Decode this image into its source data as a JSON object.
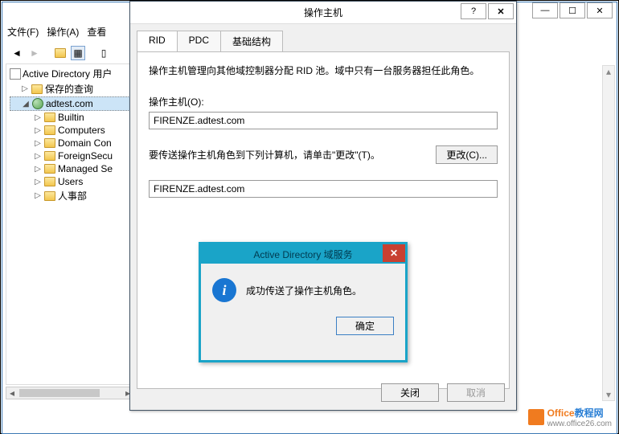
{
  "bgWindow": {
    "menus": [
      "文件(F)",
      "操作(A)",
      "查看"
    ],
    "treeRoot": "Active Directory 用户",
    "treeItems": [
      {
        "label": "保存的查询",
        "lvl": 1,
        "exp": "▷"
      },
      {
        "label": "adtest.com",
        "lvl": 1,
        "exp": "◢",
        "sel": true,
        "icon": "globe"
      },
      {
        "label": "Builtin",
        "lvl": 2,
        "exp": "▷"
      },
      {
        "label": "Computers",
        "lvl": 2,
        "exp": "▷"
      },
      {
        "label": "Domain Con",
        "lvl": 2,
        "exp": "▷"
      },
      {
        "label": "ForeignSecu",
        "lvl": 2,
        "exp": "▷"
      },
      {
        "label": "Managed Se",
        "lvl": 2,
        "exp": "▷"
      },
      {
        "label": "Users",
        "lvl": 2,
        "exp": "▷"
      },
      {
        "label": "人事部",
        "lvl": 2,
        "exp": "▷"
      }
    ]
  },
  "dialog": {
    "title": "操作主机",
    "helpBtn": "?",
    "closeBtn": "✕",
    "tabs": [
      "RID",
      "PDC",
      "基础结构"
    ],
    "desc": "操作主机管理向其他域控制器分配 RID 池。域中只有一台服务器担任此角色。",
    "hostLabel": "操作主机(O):",
    "hostValue": "FIRENZE.adtest.com",
    "transferDesc": "要传送操作主机角色到下列计算机，请单击\"更改\"(T)。",
    "changeBtn": "更改(C)...",
    "targetValue": "FIRENZE.adtest.com",
    "closeBtnFooter": "关闭",
    "cancelBtn": "取消"
  },
  "msgbox": {
    "title": "Active Directory 域服务",
    "text": "成功传送了操作主机角色。",
    "ok": "确定"
  },
  "watermark": {
    "main1": "Office",
    "main2": "教程网",
    "sub": "www.office26.com"
  }
}
